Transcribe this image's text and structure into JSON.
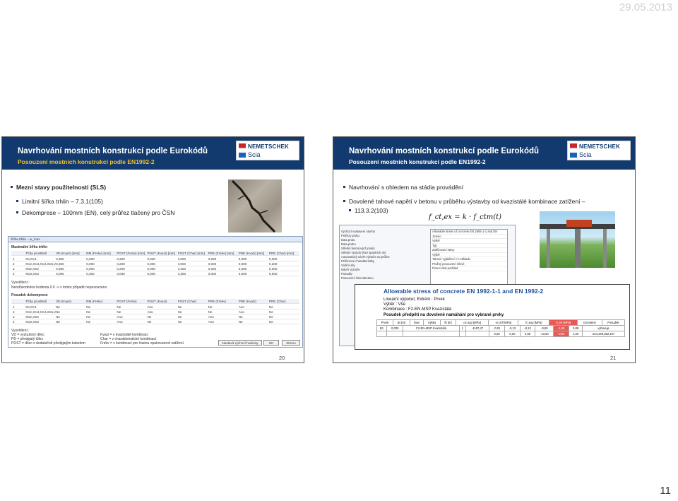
{
  "header": {
    "date": "29.05.2013"
  },
  "page_number": "11",
  "slides": [
    {
      "title": "Navrhování mostních konstrukcí podle Eurokódů",
      "subtitle": "Posouzení mostních konstrukcí podle EN1992-2",
      "logo": {
        "brand": "NEMETSCHEK",
        "sub": "Scia"
      },
      "bullets": [
        "Mezní stavy použitelnosti (SLS)",
        "Limitní šířka trhlin – 7.3.1(105)",
        "Dekomprese – 100mm (EN), celý průřez tlačený pro ČSN"
      ],
      "dialog": {
        "title": "Šířka trhlin – w_max",
        "section1": "Maximální šířka trhlin",
        "headers1": [
          "Třída prostředí",
          "VD (Kvazi) [mm]",
          "RM (Frekv) [mm]",
          "POST (Frekv) [mm]",
          "POST (Kvazi) [mm]",
          "POST (Char) [mm]",
          "PRE (Frekv) [mm]",
          "PRE (Kvazi) [mm]",
          "PRE (Char) [mm]"
        ],
        "rows1": [
          [
            "1",
            "X0,XC1",
            "0,300",
            "0,000",
            "0,200",
            "0,000",
            "0,000",
            "0,200",
            "0,000",
            "0,000"
          ],
          [
            "2",
            "XC2,XC3,XC4,XD1,XS1",
            "0,300",
            "0,000",
            "0,200",
            "0,000",
            "0,000",
            "0,000",
            "0,000",
            "0,200"
          ],
          [
            "3",
            "XD2,XS2",
            "0,300",
            "0,000",
            "0,200",
            "0,000",
            "0,200",
            "0,000",
            "0,000",
            "0,000"
          ],
          [
            "4",
            "XD3,XS3",
            "0,000",
            "0,300",
            "0,000",
            "0,000",
            "0,200",
            "0,000",
            "0,000",
            "0,000"
          ]
        ],
        "note1_label": "Vysvětlení :",
        "note1": "Neodůvodněná hodnota 0.0 -> v tomto případě neposouzeno",
        "section2": "Posudek dekomprese",
        "headers2": [
          "Třída prostředí",
          "VD (Kvazi)",
          "RM (Frekv)",
          "POST (Frekv)",
          "POST (Kvazi)",
          "POST (Char)",
          "PRE (Frekv)",
          "PRE (Kvazi)",
          "PRE (Char)"
        ],
        "rows2": [
          [
            "1",
            "X0,XC1",
            "Ne",
            "Ne",
            "Ne",
            "Ano",
            "Ne",
            "Ne",
            "Ano",
            "Ne"
          ],
          [
            "2",
            "XC2,XC3,XC4,XD1,XS1",
            "Ne",
            "Ne",
            "Ne",
            "Ano",
            "Ne",
            "Ne",
            "Ano",
            "Ne"
          ],
          [
            "3",
            "XD2,XS2",
            "Ne",
            "Ne",
            "Ano",
            "Ne",
            "Ne",
            "Ano",
            "Ne",
            "Ne"
          ],
          [
            "4",
            "XD3,XS3",
            "Ne",
            "Ne",
            "Ano",
            "Ne",
            "Ne",
            "Ano",
            "Ne",
            "Ne"
          ]
        ],
        "legend_label": "Vysvětlení :",
        "legend": [
          "VD  = vyztužený dílec",
          "PD  = předpjatý dílec",
          "POST = dílec s dodatečně předpjatým kabelem",
          "Kvazi  = v kvazistálé kombinaci",
          "Char  = v charakteristické kombinaci",
          "Frekv  = v kombinaci pro častou opakovanost zatížení"
        ],
        "buttons": {
          "defaults": "Nastavit výchozí hodnoty",
          "ok": "OK",
          "cancel": "Storno"
        }
      },
      "footer": "20"
    },
    {
      "title": "Navrhování mostních konstrukcí podle Eurokódů",
      "subtitle": "Posouzení mostních konstrukcí podle EN1992-2",
      "logo": {
        "brand": "NEMETSCHEK",
        "sub": "Scia"
      },
      "bullets": [
        "Navrhování s ohledem na stádia provádění",
        "Dovolené tahové napětí v betonu v průběhu výstavby od kvazistálé kombinace zatížení –",
        "113.3.2(103)"
      ],
      "formula": "f_ct,ex = k · f_ctm(t)",
      "software": {
        "tree": [
          "Výchozí nastavení návrhu",
          "Průřezy prvku",
          "Data prutu",
          "Data pruhu",
          "Střední betonových prvků",
          "Střední výstuže (bez spodních ok)",
          "Automatický návrh výztuže na průřez",
          "Průřezové charakteristiky",
          "Vnitřní síly",
          "Návrh výztuže",
          "Posudky",
          "Posouzení železobetonu"
        ],
        "props": [
          "Allowable stress of concrete EN 1992-1-1 and EN",
          "Jméno",
          "Výběr",
          "Typ",
          "Zatěžovací stavy",
          "Výběr",
          "Tahové vyjádření v h základu",
          "Pružný posouzení sílové",
          "Posun Stat podklad"
        ]
      },
      "stress": {
        "title": "Allowable stress of concrete EN 1992-1-1 and EN 1992-2",
        "line1": "Lineární výpočet, Extrém : Prvek",
        "line2": "Výběr : Vše",
        "line3": "Kombinace : F2-EN-MSP Kvazistálá",
        "line4": "Posudek předpětí na dovolené namáhání pro vybrané prvky",
        "headers": [
          "Prvek",
          "dx [m]",
          "Stav",
          "Výška",
          "fk [m]",
          "σc,sup [MPa]",
          "σc,inf [MPa]",
          "fc,sup [MPa]",
          "fc,inf [MPa]",
          "Dovolené",
          "Posudek"
        ],
        "rows": [
          [
            "B1",
            "0,000",
            "F2-EN-MSP Kvazistálá",
            "1",
            "-1197,47",
            "-0,01",
            "-0,13",
            "-0,13",
            "-0,90",
            "-1,08",
            "0,88",
            "vyhovuje"
          ],
          [
            "",
            "",
            "",
            "",
            "",
            "0,00",
            "0,00",
            "0,00",
            "-13,50",
            "-0,90",
            "1,00",
            "224,195,352,197"
          ]
        ]
      },
      "footer": "21"
    }
  ]
}
